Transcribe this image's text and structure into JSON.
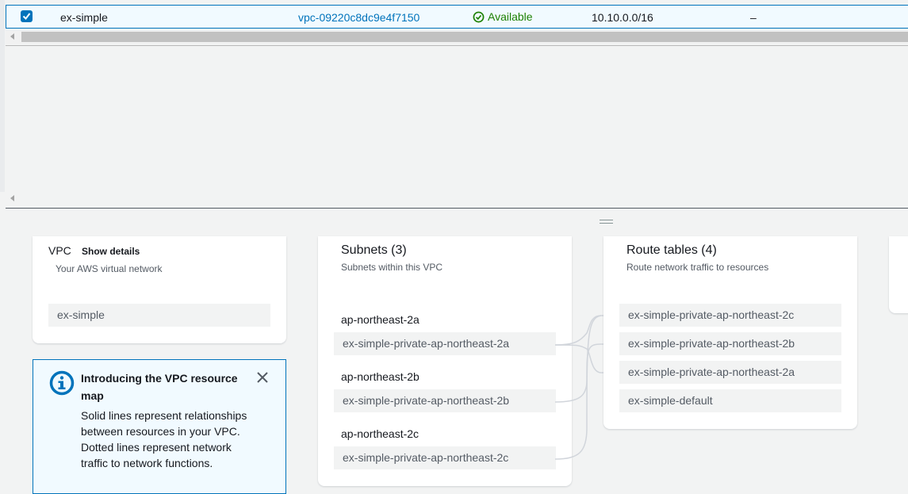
{
  "table": {
    "row": {
      "name": "ex-simple",
      "vpc_id": "vpc-09220c8dc9e4f7150",
      "state": "Available",
      "cidr": "10.10.0.0/16",
      "extra": "–"
    }
  },
  "vpc_card": {
    "title": "VPC",
    "show_details": "Show details",
    "subtitle": "Your AWS virtual network",
    "item": "ex-simple"
  },
  "info": {
    "title": "Introducing the VPC resource map",
    "body": "Solid lines represent relationships between resources in your VPC. Dotted lines represent network traffic to network functions."
  },
  "subnets_card": {
    "title": "Subnets (3)",
    "subtitle": "Subnets within this VPC",
    "groups": [
      {
        "az": "ap-northeast-2a",
        "subnet": "ex-simple-private-ap-northeast-2a"
      },
      {
        "az": "ap-northeast-2b",
        "subnet": "ex-simple-private-ap-northeast-2b"
      },
      {
        "az": "ap-northeast-2c",
        "subnet": "ex-simple-private-ap-northeast-2c"
      }
    ]
  },
  "routes_card": {
    "title": "Route tables (4)",
    "subtitle": "Route network traffic to resources",
    "items": [
      "ex-simple-private-ap-northeast-2c",
      "ex-simple-private-ap-northeast-2b",
      "ex-simple-private-ap-northeast-2a",
      "ex-simple-default"
    ]
  },
  "colors": {
    "link": "#0073bb",
    "success": "#1d8102",
    "selected_row_bg": "#f1faff"
  }
}
